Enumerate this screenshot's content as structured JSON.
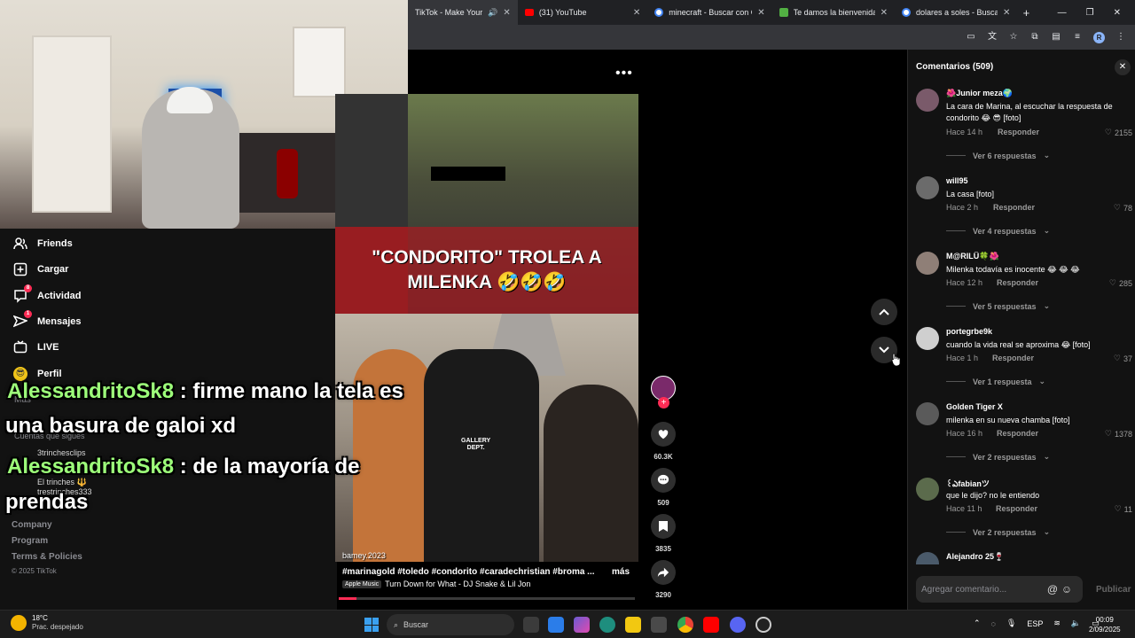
{
  "browser": {
    "tabs": [
      {
        "title": "TikTok - Make Your",
        "active": true
      },
      {
        "title": "(31) YouTube",
        "active": false
      },
      {
        "title": "minecraft - Buscar con Go",
        "active": false
      },
      {
        "title": "Te damos la bienvenida a",
        "active": false
      },
      {
        "title": "dolares a soles - Buscar co",
        "active": false
      }
    ],
    "new_tab": "+",
    "profile_initial": "R"
  },
  "sidebar": {
    "nav": [
      {
        "label": "Friends",
        "icon": "friends-icon"
      },
      {
        "label": "Cargar",
        "icon": "upload-icon"
      },
      {
        "label": "Actividad",
        "icon": "activity-icon",
        "badge": "8"
      },
      {
        "label": "Mensajes",
        "icon": "messages-icon",
        "badge": "1"
      },
      {
        "label": "LIVE",
        "icon": "live-icon"
      },
      {
        "label": "Perfil",
        "icon": "profile-icon"
      }
    ],
    "more_label": "Más",
    "following_title": "Cuentas que sigues",
    "following": [
      {
        "name": "3trinchesclips"
      },
      {
        "name": "El trinches 🔱"
      },
      {
        "name": "trestrinches333"
      }
    ],
    "footer": [
      "Company",
      "Program",
      "Terms & Policies"
    ],
    "copyright": "© 2025 TikTok"
  },
  "stream_chat": [
    {
      "user": "AlessandritoSk8",
      "line1": " : firme mano la tela es",
      "line2": "una basura de galoi xd"
    },
    {
      "user": "AlessandritoSk8",
      "line1": " : de la mayoría de",
      "line2": "prendas"
    }
  ],
  "video": {
    "caption_line1": "\"CONDORITO\" TROLEA A",
    "caption_line2": "MILENKA 🤣🤣🤣",
    "shirt_text": "GALLERY\nDEPT.",
    "username": "bamey.2023",
    "hashtags": "#marinagold #toledo #condorito #caradechristian #broma ...",
    "more": "más",
    "music_tag": "Apple Music",
    "music": "Turn Down for What - DJ Snake & Lil Jon",
    "progress": 0.06,
    "more_dots": "•••",
    "likes": "60.3K",
    "comments": "509",
    "saves": "3835",
    "shares": "3290"
  },
  "comments_panel": {
    "title": "Comentarios (509)",
    "reply_label": "Responder",
    "input_placeholder": "Agregar comentario...",
    "post_label": "Publicar",
    "items": [
      {
        "user": "🌺Junior meza🌍",
        "text": "La cara de Marina, al escuchar la respuesta de condorito 😂 😎 [foto]",
        "time": "Hace 14 h",
        "likes": "2155",
        "replies": "Ver 6 respuestas",
        "avatar": "#7a5a6a"
      },
      {
        "user": "will95",
        "text": "La casa [foto]",
        "time": "Hace 2 h",
        "likes": "78",
        "replies": "Ver 4 respuestas",
        "avatar": "#6b6b6b"
      },
      {
        "user": "M@RILÜ🍀🌺",
        "text": "Milenka todavía es inocente 😂 😂 😂",
        "time": "Hace 12 h",
        "likes": "285",
        "replies": "Ver 5 respuestas",
        "avatar": "#8f7f77"
      },
      {
        "user": "portegrbe9k",
        "text": "cuando la vida real se aproxima 😂 [foto]",
        "time": "Hace 1 h",
        "likes": "37",
        "replies": "Ver 1 respuesta",
        "avatar": "#cfcfcf"
      },
      {
        "user": "Golden Tiger X",
        "text": "milenka en su nueva chamba [foto]",
        "time": "Hace 16 h",
        "likes": "1378",
        "replies": "Ver 2 respuestas",
        "avatar": "#5a5a5a"
      },
      {
        "user": "꒰ఎfabianツ",
        "text": "que le dijo? no le entiendo",
        "time": "Hace 11 h",
        "likes": "11",
        "replies": "Ver 2 respuestas",
        "avatar": "#5b6b4c"
      },
      {
        "user": "Alejandro 25🍷",
        "text": "",
        "time": "",
        "likes": "",
        "replies": "",
        "avatar": "#4a5a6a"
      }
    ]
  },
  "taskbar": {
    "weather_temp": "18°C",
    "weather_desc": "Prac. despejado",
    "search_placeholder": "Buscar",
    "lang": "ESP",
    "time": "00:09",
    "date": "2/09/2025",
    "colors": {
      "accent": "#fe2c55",
      "chat_user": "#9dff7a"
    }
  }
}
